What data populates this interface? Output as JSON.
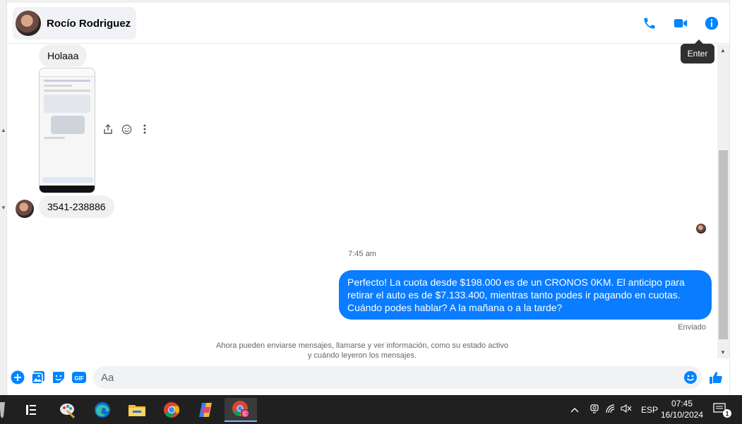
{
  "header": {
    "contact_name": "Rocío Rodriguez",
    "icons": [
      "phone-icon",
      "video-icon",
      "info-icon"
    ]
  },
  "tooltip": {
    "label": "Enter"
  },
  "messages": {
    "first_in": "Holaaa",
    "phone_in": "3541-238886",
    "timestamp": "7:45 am",
    "out_text": "Perfecto! La cuota desde $198.000 es de un CRONOS 0KM. El anticipo para retirar el auto es de $7.133.400, mientras tanto podes ir pagando en cuotas. Cuándo podes hablar? A la mañana o a la tarde?",
    "status": "Enviado",
    "notice_line1": "Ahora pueden enviarse mensajes, llamarse y ver información, como su estado activo",
    "notice_line2": "y cuándo leyeron los mensajes."
  },
  "composer": {
    "placeholder": "Aa",
    "gif_label": "GIF"
  },
  "taskbar": {
    "language": "ESP",
    "time": "07:45",
    "date": "16/10/2024",
    "notifications_count": "1"
  },
  "colors": {
    "accent": "#0a7cff",
    "messenger_blue": "#0084ff",
    "taskbar_bg": "#202020"
  }
}
